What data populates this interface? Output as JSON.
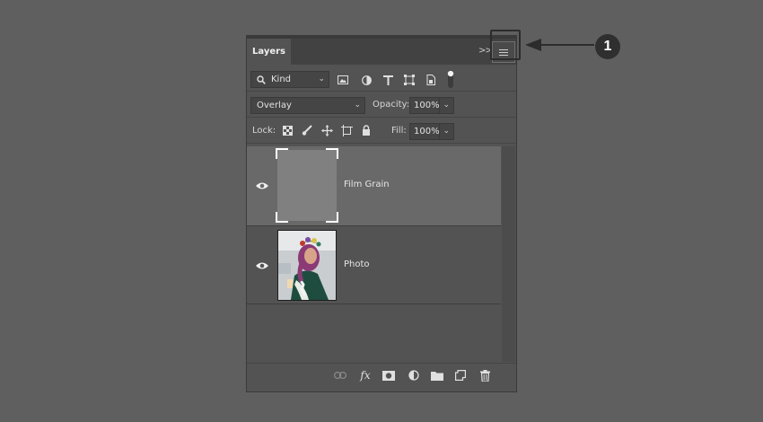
{
  "panel": {
    "tab_label": "Layers",
    "collapse_glyph": ">>",
    "menu_icon": "hamburger-menu-icon"
  },
  "filter": {
    "kind_label": "Kind",
    "icons": [
      "image-filter-icon",
      "adjustment-filter-icon",
      "type-filter-icon",
      "shape-filter-icon",
      "smart-object-filter-icon",
      "filter-toggle-icon"
    ]
  },
  "blend": {
    "mode": "Overlay",
    "opacity_label": "Opacity:",
    "opacity_value": "100%"
  },
  "lock": {
    "label": "Lock:",
    "icons": [
      "lock-transparent-pixels-icon",
      "lock-image-pixels-icon",
      "lock-position-icon",
      "lock-artboard-icon",
      "lock-all-icon"
    ],
    "fill_label": "Fill:",
    "fill_value": "100%"
  },
  "layers": [
    {
      "name": "Film Grain",
      "visible": true,
      "selected": true,
      "thumb_color": "#808080"
    },
    {
      "name": "Photo",
      "visible": true,
      "selected": false
    }
  ],
  "footer_icons": [
    "link-layers-icon",
    "fx-icon",
    "add-mask-icon",
    "adjustment-layer-icon",
    "new-group-icon",
    "new-layer-icon",
    "delete-icon"
  ],
  "callout": {
    "number": "1"
  }
}
